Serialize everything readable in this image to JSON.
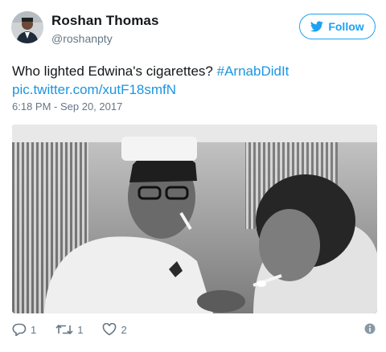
{
  "author": {
    "name": "Roshan Thomas",
    "handle": "@roshanpty"
  },
  "follow_button": {
    "label": "Follow",
    "icon": "twitter-bird-icon"
  },
  "tweet": {
    "text": "Who lighted Edwina's cigarettes?",
    "hashtag": "#ArnabDidIt",
    "link": "pic.twitter.com/xutF18smfN",
    "timestamp": "6:18 PM - Sep 20, 2017"
  },
  "media": {
    "description_icon": "black-and-white-photo"
  },
  "actions": {
    "reply": {
      "icon": "reply-icon",
      "count": "1"
    },
    "retweet": {
      "icon": "retweet-icon",
      "count": "1"
    },
    "like": {
      "icon": "heart-icon",
      "count": "2"
    },
    "info": {
      "icon": "info-icon"
    }
  },
  "colors": {
    "accent": "#1da1f2",
    "link": "#1b95e0",
    "muted": "#657786",
    "text": "#14171a"
  }
}
